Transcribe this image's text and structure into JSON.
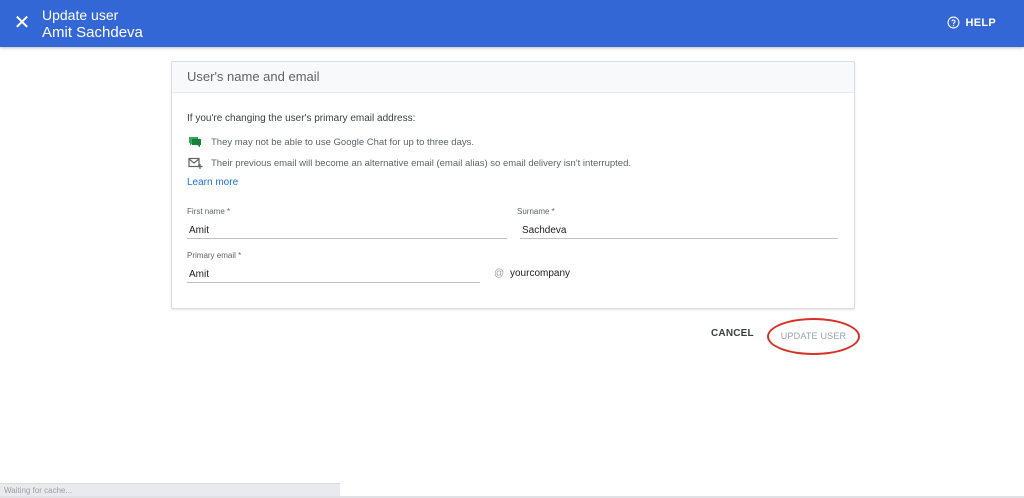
{
  "header": {
    "close_icon": "close-icon",
    "title": "Update user",
    "subtitle": "Amit Sachdeva",
    "help_label": "HELP",
    "help_icon": "help-circle-icon"
  },
  "card": {
    "title": "User's name and email",
    "intro": "If you're changing the user's primary email address:",
    "notes": [
      {
        "icon": "google-chat-icon",
        "text": "They may not be able to use Google Chat for up to three days."
      },
      {
        "icon": "mail-add-icon",
        "text": "Their previous email will become an alternative email (email alias) so email delivery isn't interrupted."
      }
    ],
    "learn_more": "Learn more",
    "first_name": {
      "label": "First name *",
      "value": "Amit"
    },
    "surname": {
      "label": "Surname *",
      "value": "Sachdeva"
    },
    "primary_email": {
      "label": "Primary email *",
      "value": "Amit"
    },
    "at_symbol": "@",
    "domain": "yourcompany"
  },
  "actions": {
    "cancel": "CANCEL",
    "update": "UPDATE USER"
  },
  "status_bar": "Waiting for cache...",
  "colors": {
    "header": "#3367d6",
    "link": "#1a73e8",
    "highlight_ring": "#d93025"
  }
}
